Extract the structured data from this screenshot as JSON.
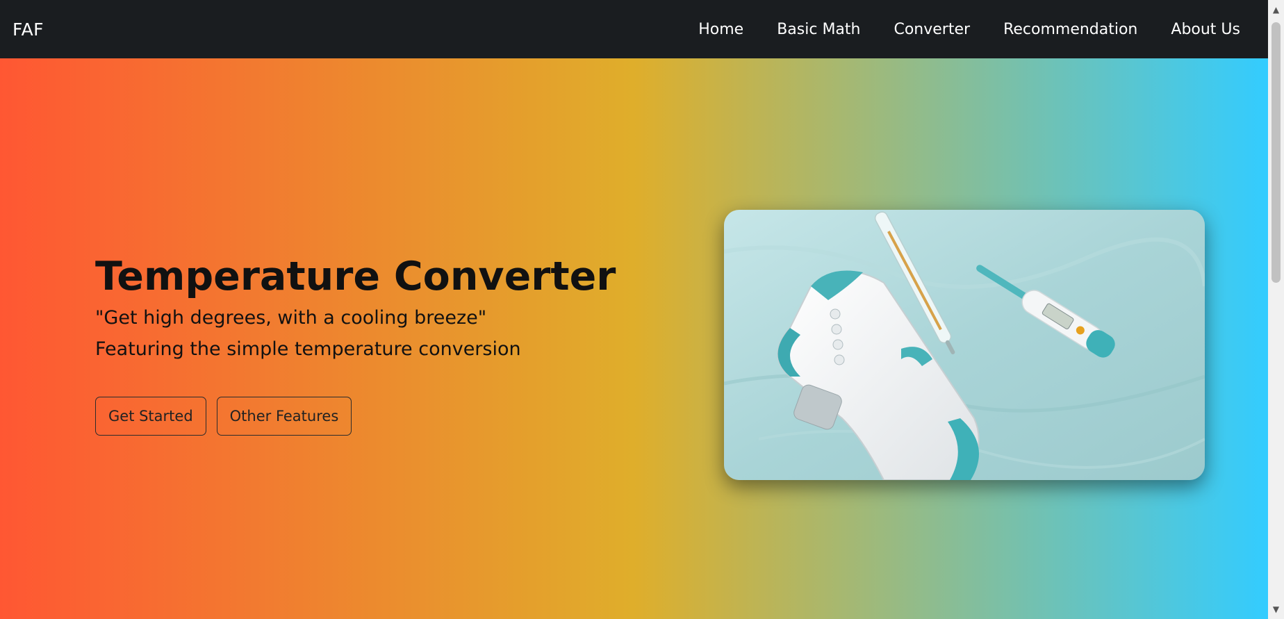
{
  "navbar": {
    "brand": "FAF",
    "links": [
      "Home",
      "Basic Math",
      "Converter",
      "Recommendation",
      "About Us"
    ]
  },
  "hero": {
    "title": "Temperature Converter",
    "quote": "\"Get high degrees, with a cooling breeze\"",
    "subtitle": "Featuring the simple temperature conversion",
    "buttons": {
      "get_started": "Get Started",
      "other_features": "Other Features"
    },
    "image_alt": "Thermometers on a teal surface"
  },
  "colors": {
    "navbar_bg": "#1a1d20",
    "gradient_start": "#ff5733",
    "gradient_mid": "#dfae2b",
    "gradient_end": "#33ccff"
  },
  "icons": {
    "scroll_up": "chevron-up-icon",
    "scroll_down": "chevron-down-icon"
  }
}
